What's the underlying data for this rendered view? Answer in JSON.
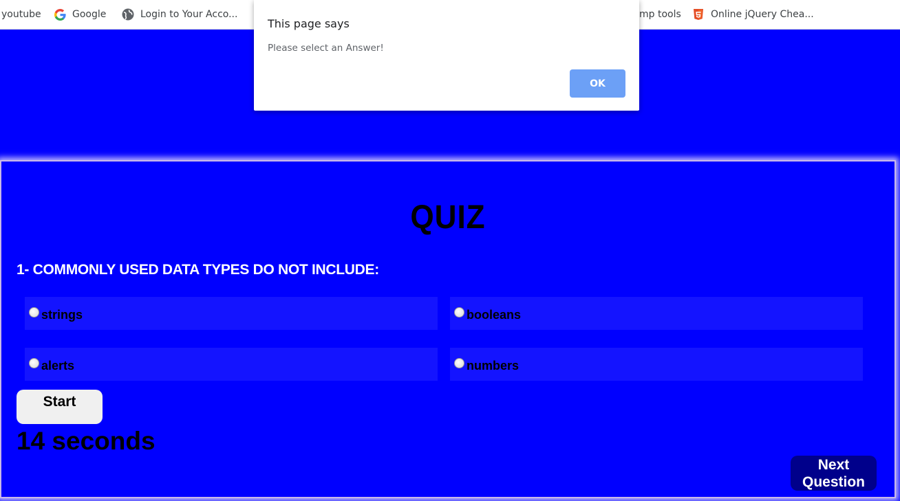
{
  "bookmarks": [
    {
      "label": "youtube",
      "icon": "none"
    },
    {
      "label": "Google",
      "icon": "google-icon"
    },
    {
      "label": "Login to Your Acco...",
      "icon": "globe-icon"
    },
    {
      "label": "mp tools",
      "icon": "none"
    },
    {
      "label": "Online jQuery Chea...",
      "icon": "html5-icon"
    }
  ],
  "dialog": {
    "title": "This page says",
    "message": "Please select an Answer!",
    "ok_label": "OK"
  },
  "quiz": {
    "title": "QUIZ",
    "question": "1- COMMONLY USED DATA TYPES DO NOT INCLUDE:",
    "answers": [
      "strings",
      "booleans",
      "alerts",
      "numbers"
    ],
    "start_label": "Start",
    "timer": "14 seconds",
    "next_label_line1": "Next",
    "next_label_line2": "Question"
  },
  "colors": {
    "page_background": "#0000ff",
    "answer_background": "#1414ff",
    "next_button": "#00008b",
    "ok_button": "#6ca0f6"
  }
}
